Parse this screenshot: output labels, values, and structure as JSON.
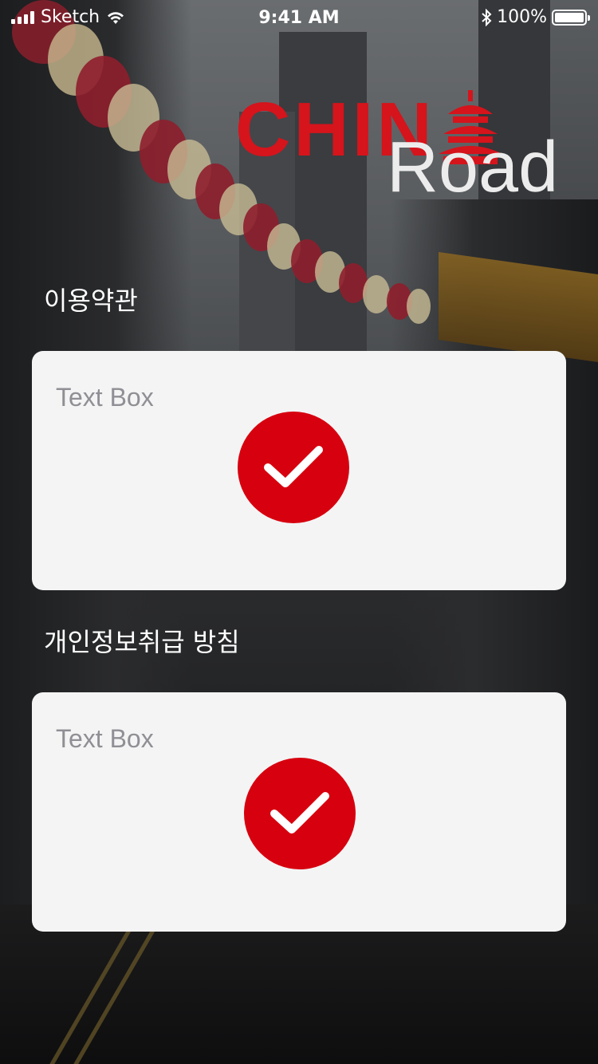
{
  "status_bar": {
    "carrier": "Sketch",
    "time": "9:41 AM",
    "battery_percent": "100%",
    "battery_level": 1.0
  },
  "logo": {
    "word1": "CHIN",
    "word2": "Road",
    "brand_red": "#d5141c"
  },
  "terms": {
    "title": "이용약관",
    "textbox_placeholder": "Text Box",
    "checked": true
  },
  "privacy": {
    "title": "개인정보취급 방침",
    "textbox_placeholder": "Text Box",
    "checked": true
  },
  "colors": {
    "accent": "#d7000f",
    "card_bg": "#f4f4f4"
  },
  "icons": [
    "signal-icon",
    "wifi-icon",
    "bluetooth-icon",
    "battery-icon",
    "pagoda-icon",
    "checkmark-icon"
  ]
}
